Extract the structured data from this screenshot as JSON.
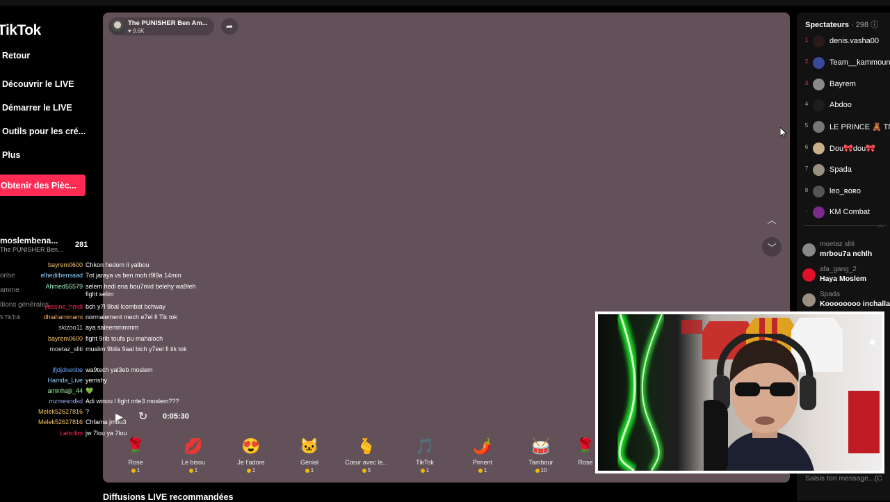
{
  "sidebar": {
    "logo": "TikTok",
    "nav": [
      "Retour",
      "Découvrir le LIVE",
      "Démarrer le LIVE",
      "Outils pour les cré...",
      "Plus"
    ],
    "coins_button": "Obtenir des Pièc...",
    "host_name": "moslembena...",
    "host_sub": "The PUNISHER Ben...",
    "host_count": "281",
    "faint_items": [
      "orise",
      "amme",
      "itions générales",
      "5 TikTok"
    ]
  },
  "stage": {
    "host_chip_name": "The PUNISHER Ben Am...",
    "host_chip_likes": "♥ 9.6K",
    "timer": "0:05:30",
    "bg_color": "#625159"
  },
  "chat": [
    {
      "user": "bayrem0600",
      "msg": "Chkon hedom li yalbou",
      "color": "#f7c46c"
    },
    {
      "user": "elhedilbensaad",
      "msg": "7ot jaraya vs ben moh t9l9a 14min",
      "color": "#8fd3ff"
    },
    {
      "user": "Ahmed55579",
      "msg": "selem hedi ena bou7mid belehy wa9teh fight selim",
      "color": "#9ef0c2"
    },
    {
      "user": "yessine_hmdi",
      "msg": "bch y7l 9bal lcombat bchway",
      "color": "#fe2c55"
    },
    {
      "user": "dhiahammami",
      "msg": "normalement mech e7el fi Tik tok",
      "color": "#f7b26c"
    },
    {
      "user": "skizoo11",
      "msg": "aya saleemmmmm",
      "color": "#cccccc"
    },
    {
      "user": "bayrem0600",
      "msg": "fight 9rib toufa pu mahaloch",
      "color": "#f7c46c"
    },
    {
      "user": "moetaz_sliti",
      "msg": "muslim 9bila 9aal bich y7eel fi tik tok",
      "color": "#dddddd"
    },
    {
      "user": "jfjdjdnenbe",
      "msg": "wa9tech yal3eb moslem",
      "color": "#6ca8ff"
    },
    {
      "user": "Hamda_Live",
      "msg": "yemshy",
      "color": "#8fd3ff"
    },
    {
      "user": "aminhajji_44",
      "msg": "💚",
      "color": "#9ef09e"
    },
    {
      "user": "mzmesndkd",
      "msg": "Adi winou l fight mte3 moslem???",
      "color": "#9ea8ff"
    },
    {
      "user": "Melek52627816",
      "msg": "?",
      "color": "#f7c46c"
    },
    {
      "user": "Melek52627816",
      "msg": "Chfama jmou3",
      "color": "#f7c46c"
    },
    {
      "user": "Lahcilim",
      "msg": "jw 7lou ya 7lou",
      "color": "#fe2c55"
    }
  ],
  "gifts": [
    {
      "icon": "🌹",
      "name": "Rose",
      "price": "1"
    },
    {
      "icon": "💋",
      "name": "Le bisou",
      "price": "1"
    },
    {
      "icon": "😍",
      "name": "Je t'adore",
      "price": "1"
    },
    {
      "icon": "🐱",
      "name": "Génial",
      "price": "1"
    },
    {
      "icon": "🫰",
      "name": "Cœur avec le...",
      "price": "5"
    },
    {
      "icon": "🎵",
      "name": "TikTok",
      "price": "1"
    },
    {
      "icon": "🌶️",
      "name": "Piment",
      "price": "1"
    },
    {
      "icon": "🥁",
      "name": "Tambour",
      "price": "10"
    },
    {
      "icon": "🌹",
      "name": "Rose",
      "price": ""
    }
  ],
  "recommended_title": "Diffusions LIVE recommandées",
  "spectators": {
    "title": "Spectateurs",
    "count": "· 298",
    "viewers": [
      {
        "rank": "1",
        "name": "denis.vasha00",
        "rank_color": "#fe2c55",
        "avatar": "#2a1a1a"
      },
      {
        "rank": "2",
        "name": "Team__kammoun",
        "rank_color": "#fe2c55",
        "avatar": "#3a4a9a"
      },
      {
        "rank": "3",
        "name": "Bayrem",
        "rank_color": "#fe2c55",
        "avatar": "#8a8a8a"
      },
      {
        "rank": "4",
        "name": "Abdoo",
        "rank_color": "#aaaaaa",
        "avatar": "#1e1e1e"
      },
      {
        "rank": "5",
        "name": "LE PRINCE 🧸 TN",
        "rank_color": "#aaaaaa",
        "avatar": "#777777"
      },
      {
        "rank": "6",
        "name": "Dou🎀dou🎀",
        "rank_color": "#aaaaaa",
        "avatar": "#c9b08a"
      },
      {
        "rank": "7",
        "name": "Spada",
        "rank_color": "#aaaaaa",
        "avatar": "#9a9080"
      },
      {
        "rank": "8",
        "name": "leo_ʀᴏʀᴏ",
        "rank_color": "#aaaaaa",
        "avatar": "#555555"
      },
      {
        "rank": "-",
        "name": "KM Combat",
        "rank_color": "#aaaaaa",
        "avatar": "#7a2a8a"
      }
    ],
    "comments": [
      {
        "user": "moetaz sliti",
        "msg": "mrbou7a nchlh",
        "avatar": "#888888"
      },
      {
        "user": "afa_gang_2",
        "msg": "Haya Moslem",
        "avatar": "#e0102a"
      },
      {
        "user": "Spada",
        "msg": "Koooooooo inchallah",
        "avatar": "#9a9080"
      }
    ],
    "input_placeholder": "Saisis ton message...(C"
  }
}
